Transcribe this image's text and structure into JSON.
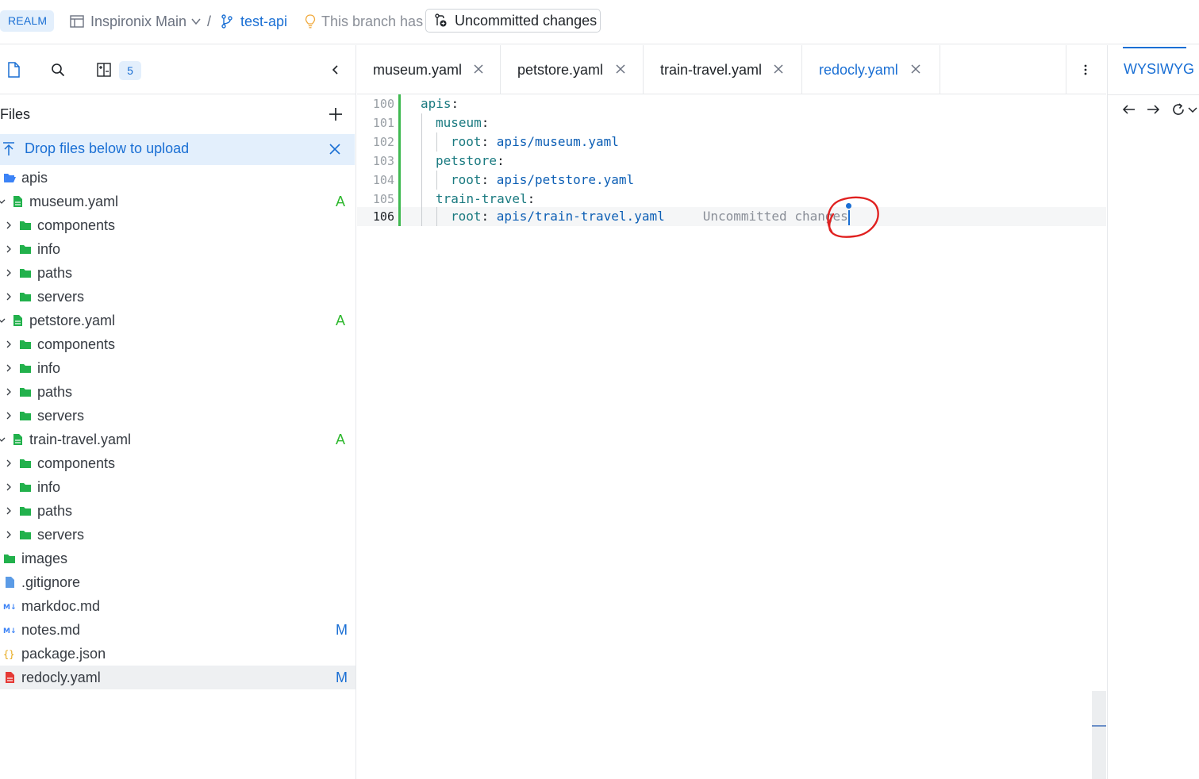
{
  "header": {
    "realm_badge": "REALM",
    "project_name": "Inspironix Main",
    "separator": "/",
    "branch_name": "test-api",
    "branch_note": "This branch has",
    "uncommitted_button": "Uncommitted changes"
  },
  "sidebar": {
    "changes_count": "5",
    "files_title": "Files",
    "upload_label": "Drop files below to upload",
    "tree": [
      {
        "label": "apis",
        "icon": "folder-open-icon",
        "depth": 0,
        "caret": "",
        "status": ""
      },
      {
        "label": "museum.yaml",
        "icon": "yaml-file-icon",
        "depth": 1,
        "caret": "down",
        "status": "A"
      },
      {
        "label": "components",
        "icon": "folder-icon",
        "depth": 2,
        "caret": "right",
        "status": ""
      },
      {
        "label": "info",
        "icon": "folder-icon",
        "depth": 2,
        "caret": "right",
        "status": ""
      },
      {
        "label": "paths",
        "icon": "folder-icon",
        "depth": 2,
        "caret": "right",
        "status": ""
      },
      {
        "label": "servers",
        "icon": "folder-icon",
        "depth": 2,
        "caret": "right",
        "status": ""
      },
      {
        "label": "petstore.yaml",
        "icon": "yaml-file-icon",
        "depth": 1,
        "caret": "down",
        "status": "A"
      },
      {
        "label": "components",
        "icon": "folder-icon",
        "depth": 2,
        "caret": "right",
        "status": ""
      },
      {
        "label": "info",
        "icon": "folder-icon",
        "depth": 2,
        "caret": "right",
        "status": ""
      },
      {
        "label": "paths",
        "icon": "folder-icon",
        "depth": 2,
        "caret": "right",
        "status": ""
      },
      {
        "label": "servers",
        "icon": "folder-icon",
        "depth": 2,
        "caret": "right",
        "status": ""
      },
      {
        "label": "train-travel.yaml",
        "icon": "yaml-file-icon",
        "depth": 1,
        "caret": "down",
        "status": "A"
      },
      {
        "label": "components",
        "icon": "folder-icon",
        "depth": 2,
        "caret": "right",
        "status": ""
      },
      {
        "label": "info",
        "icon": "folder-icon",
        "depth": 2,
        "caret": "right",
        "status": ""
      },
      {
        "label": "paths",
        "icon": "folder-icon",
        "depth": 2,
        "caret": "right",
        "status": ""
      },
      {
        "label": "servers",
        "icon": "folder-icon",
        "depth": 2,
        "caret": "right",
        "status": ""
      },
      {
        "label": "images",
        "icon": "folder-icon",
        "depth": 0,
        "caret": "",
        "status": ""
      },
      {
        "label": ".gitignore",
        "icon": "file-icon",
        "depth": 0,
        "caret": "",
        "status": ""
      },
      {
        "label": "markdoc.md",
        "icon": "markdown-icon",
        "depth": 0,
        "caret": "",
        "status": ""
      },
      {
        "label": "notes.md",
        "icon": "markdown-icon",
        "depth": 0,
        "caret": "",
        "status": "M"
      },
      {
        "label": "package.json",
        "icon": "json-icon",
        "depth": 0,
        "caret": "",
        "status": ""
      },
      {
        "label": "redocly.yaml",
        "icon": "redocly-file-icon",
        "depth": 0,
        "caret": "",
        "status": "M",
        "selected": true
      }
    ]
  },
  "editor": {
    "tabs": [
      {
        "label": "museum.yaml",
        "active": false
      },
      {
        "label": "petstore.yaml",
        "active": false
      },
      {
        "label": "train-travel.yaml",
        "active": false
      },
      {
        "label": "redocly.yaml",
        "active": true
      }
    ],
    "lines": [
      {
        "number": "100",
        "key": "apis",
        "value": ""
      },
      {
        "number": "101",
        "key": "museum",
        "value": ""
      },
      {
        "number": "102",
        "key": "root",
        "value": "apis/museum.yaml"
      },
      {
        "number": "103",
        "key": "petstore",
        "value": ""
      },
      {
        "number": "104",
        "key": "root",
        "value": "apis/petstore.yaml"
      },
      {
        "number": "105",
        "key": "train-travel",
        "value": ""
      },
      {
        "number": "106",
        "key": "root",
        "value": "apis/train-travel.yaml",
        "current": true
      }
    ],
    "ghost_text": "Uncommitted changes"
  },
  "right_panel": {
    "tab_label": "WYSIWYG"
  },
  "colors": {
    "accent": "#1a6fd4",
    "added": "#2eb82e",
    "folder_green": "#22b14c",
    "annotation": "#e0201f"
  }
}
